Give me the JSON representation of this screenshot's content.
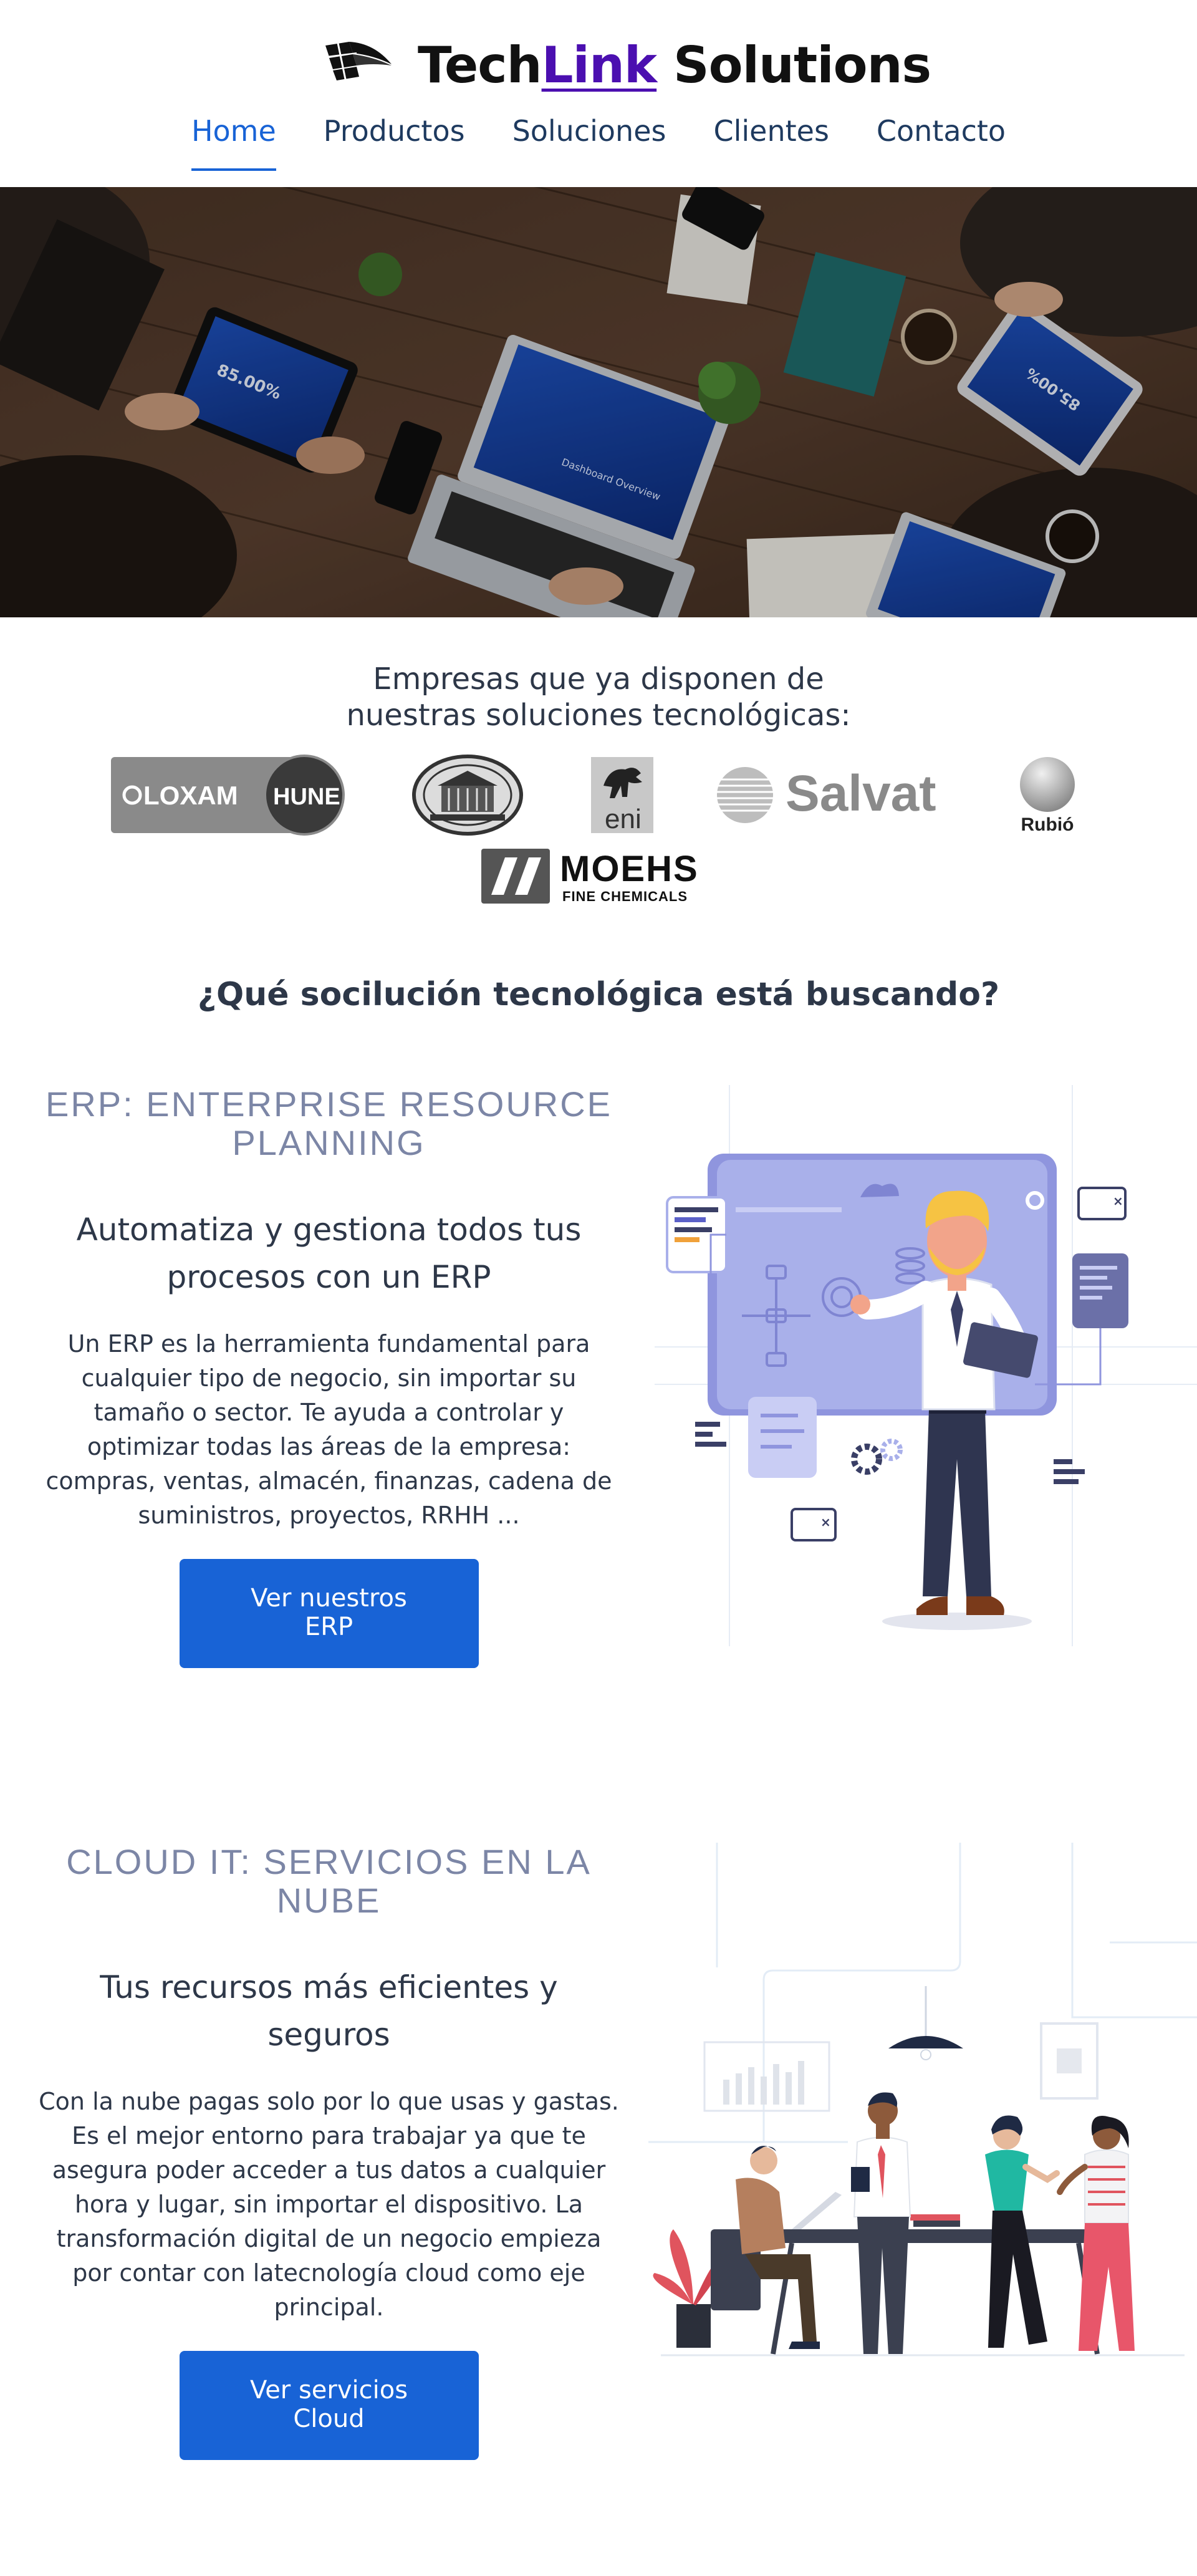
{
  "brand": {
    "name_part1": "Tech",
    "name_part2": "Link",
    "name_part3": " Solutions",
    "accent": "#4b0fb0"
  },
  "nav": {
    "items": [
      {
        "label": "Home",
        "active": true
      },
      {
        "label": "Productos",
        "active": false
      },
      {
        "label": "Soluciones",
        "active": false
      },
      {
        "label": "Clientes",
        "active": false
      },
      {
        "label": "Contacto",
        "active": false
      }
    ],
    "active_color": "#1863d6"
  },
  "hero": {
    "image": "photo-of-team-working-with-laptops-and-tablets",
    "screen_text_left": "85.00%",
    "screen_text_right": "85.00%",
    "screen_text_laptop": "Dashboard Overview"
  },
  "clients": {
    "title_line1": "Empresas que ya disponen de",
    "title_line2": "nuestras soluciones tecnológicas:",
    "logos": [
      {
        "name": "loxam-hune",
        "text1": "LOXAM",
        "text2": "HUNE"
      },
      {
        "name": "la-tarragona-seal",
        "text1": ""
      },
      {
        "name": "eni",
        "text1": "eni"
      },
      {
        "name": "salvat",
        "text1": "Salvat"
      },
      {
        "name": "rubio",
        "text1": "Rubió"
      },
      {
        "name": "moehs",
        "text1": "MOEHS",
        "text2": "FINE CHEMICALS"
      }
    ]
  },
  "question": "¿Qué socilución tecnológica está buscando?",
  "erp": {
    "kicker_line1": "ERP: ENTERPRISE RESOURCE",
    "kicker_line2": "PLANNING",
    "heading_line1": "Automatiza y gestiona todos tus",
    "heading_line2": "procesos con un ERP",
    "body_lines": [
      "Un ERP es la herramienta fundamental para",
      "cualquier tipo de negocio, sin importar su",
      "tamaño o sector. Te ayuda a controlar y",
      "optimizar todas las áreas de la empresa:",
      "compras, ventas, almacén, finanzas, cadena de",
      "suministros, proyectos, RRHH ..."
    ],
    "button_line1": "Ver nuestros",
    "button_line2": "ERP"
  },
  "cloud": {
    "kicker_line1": "CLOUD IT: SERVICIOS EN LA",
    "kicker_line2": "NUBE",
    "heading_line1": "Tus recursos más eficientes y",
    "heading_line2": "seguros",
    "body_lines": [
      "Con la nube pagas solo por lo que usas y gastas.",
      "Es el mejor entorno para trabajar ya que te",
      "asegura poder acceder a tus datos a cualquier",
      "hora y lugar, sin importar el dispositivo. La",
      "transformación digital de un negocio empieza",
      "por contar con latecnología cloud como eje",
      "principal."
    ],
    "button_line1": "Ver servicios",
    "button_line2": "Cloud"
  }
}
